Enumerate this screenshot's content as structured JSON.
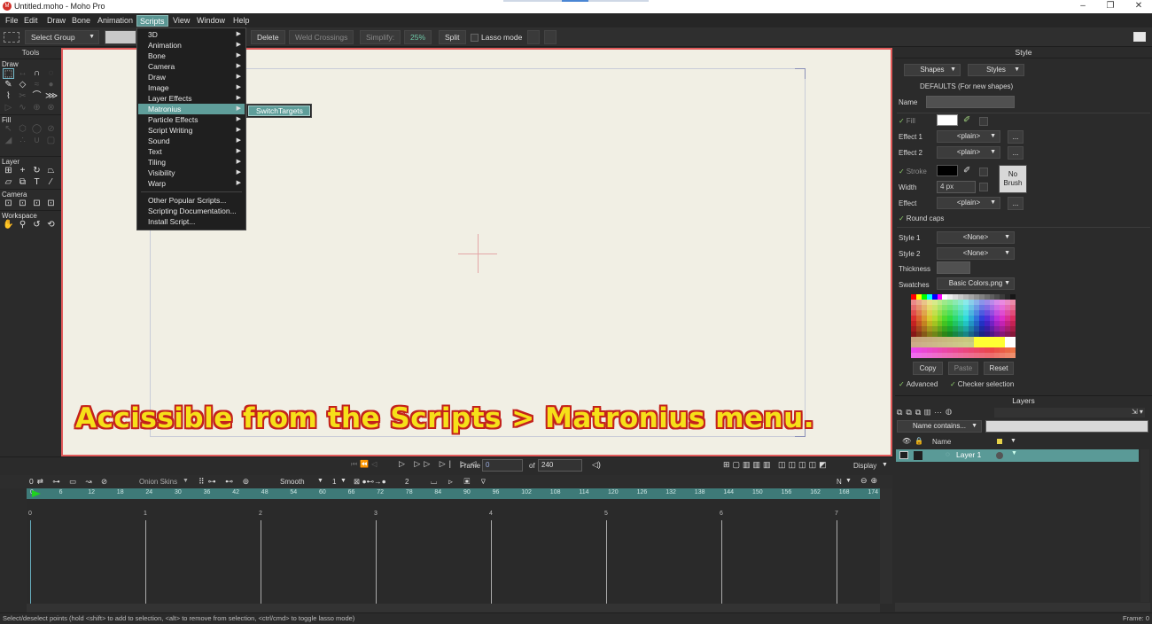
{
  "window": {
    "title": "Untitled.moho - Moho Pro",
    "logo_text": "M",
    "min_glyph": "–",
    "max_glyph": "❐",
    "close_glyph": "✕"
  },
  "menubar": [
    "File",
    "Edit",
    "Draw",
    "Bone",
    "Animation",
    "Scripts",
    "View",
    "Window",
    "Help"
  ],
  "toolbar": {
    "select_group": "Select Group",
    "delete": "Delete",
    "weld_crossings": "Weld Crossings",
    "simplify_label": "Simplify:",
    "simplify_value": "25%",
    "split": "Split",
    "lasso_mode": "Lasso mode"
  },
  "tools": {
    "header": "Tools",
    "draw": "Draw",
    "fill": "Fill",
    "layer": "Layer",
    "camera": "Camera",
    "workspace": "Workspace"
  },
  "scripts_menu": {
    "items": [
      "3D",
      "Animation",
      "Bone",
      "Camera",
      "Draw",
      "Image",
      "Layer Effects",
      "Matronius",
      "Particle Effects",
      "Script Writing",
      "Sound",
      "Text",
      "Tiling",
      "Visibility",
      "Warp"
    ],
    "extra": [
      "Other Popular Scripts...",
      "Scripting Documentation...",
      "Install Script..."
    ],
    "submenu_item": "SwitchTargets",
    "arrow": "▶"
  },
  "caption": "Accissible from the Scripts > Matronius menu.",
  "style_panel": {
    "header": "Style",
    "shapes": "Shapes",
    "styles": "Styles",
    "defaults": "DEFAULTS (For new shapes)",
    "name": "Name",
    "fill": "Fill",
    "effect1": "Effect 1",
    "effect2": "Effect 2",
    "plain": "<plain>",
    "stroke": "Stroke",
    "width": "Width",
    "width_value": "4 px",
    "effect": "Effect",
    "no_brush": "No Brush",
    "round_caps": "Round caps",
    "style1": "Style 1",
    "style2": "Style 2",
    "none": "<None>",
    "thickness": "Thickness",
    "swatches": "Swatches",
    "swatch_file": "Basic Colors.png",
    "copy": "Copy",
    "paste": "Paste",
    "reset": "Reset",
    "advanced": "Advanced",
    "checker_selection": "Checker selection",
    "ellipsis": "...",
    "fill_color": "#ffffff",
    "stroke_color": "#000000"
  },
  "layers_panel": {
    "header": "Layers",
    "filter": "Name contains...",
    "name_col": "Name",
    "layer1": "Layer 1",
    "row_color": "#5a9a97"
  },
  "timeline": {
    "frame_label": "Frame",
    "frame_value": "0",
    "of_label": "of",
    "total_frames": "240",
    "display": "Display",
    "onion_skins": "Onion Skins",
    "smooth": "Smooth",
    "interp_value": "1",
    "keys_value": "2",
    "n_label": "N",
    "ruler_ticks": [
      "0",
      "6",
      "12",
      "18",
      "24",
      "30",
      "36",
      "42",
      "48",
      "54",
      "60",
      "66",
      "72",
      "78",
      "84",
      "90",
      "96",
      "102",
      "108",
      "114",
      "120",
      "126",
      "132",
      "138",
      "144",
      "150",
      "156",
      "162",
      "168",
      "174"
    ],
    "second_marks": [
      "0",
      "1",
      "2",
      "3",
      "4",
      "5",
      "6",
      "7"
    ]
  },
  "statusbar": {
    "hint": "Select/deselect points (hold <shift> to add to selection, <alt> to remove from selection, <ctrl/cmd> to toggle lasso mode)",
    "frame": "Frame: 0"
  }
}
